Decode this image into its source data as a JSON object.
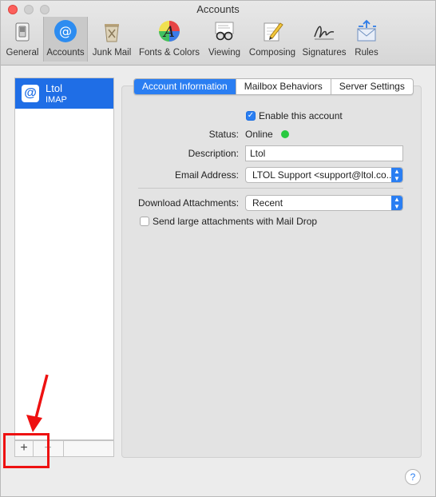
{
  "window": {
    "title": "Accounts"
  },
  "toolbar": {
    "items": [
      {
        "label": "General",
        "icon": "general-switch-icon"
      },
      {
        "label": "Accounts",
        "icon": "at-sign-icon"
      },
      {
        "label": "Junk Mail",
        "icon": "trash-bin-icon"
      },
      {
        "label": "Fonts & Colors",
        "icon": "fonts-palette-icon"
      },
      {
        "label": "Viewing",
        "icon": "glasses-icon"
      },
      {
        "label": "Composing",
        "icon": "pencil-paper-icon"
      },
      {
        "label": "Signatures",
        "icon": "signature-icon"
      },
      {
        "label": "Rules",
        "icon": "rules-envelope-icon"
      }
    ],
    "selected": "Accounts"
  },
  "sidebar": {
    "accounts": [
      {
        "name": "Ltol",
        "type": "IMAP"
      }
    ],
    "add_label": "+",
    "remove_label": "−"
  },
  "tabs": [
    {
      "label": "Account Information",
      "active": true
    },
    {
      "label": "Mailbox Behaviors",
      "active": false
    },
    {
      "label": "Server Settings",
      "active": false
    }
  ],
  "form": {
    "enable_label": "Enable this account",
    "enable_checked": true,
    "status_label": "Status:",
    "status_value": "Online",
    "status_color": "#28c940",
    "description_label": "Description:",
    "description_value": "Ltol",
    "email_label": "Email Address:",
    "email_value": "LTOL Support <support@ltol.co...",
    "download_label": "Download Attachments:",
    "download_value": "Recent",
    "maildrop_label": "Send large attachments with Mail Drop",
    "maildrop_checked": false
  },
  "help_label": "?",
  "colors": {
    "accent": "#2a7ef2",
    "selection": "#1f6ee6",
    "annotation": "#ee1111"
  }
}
